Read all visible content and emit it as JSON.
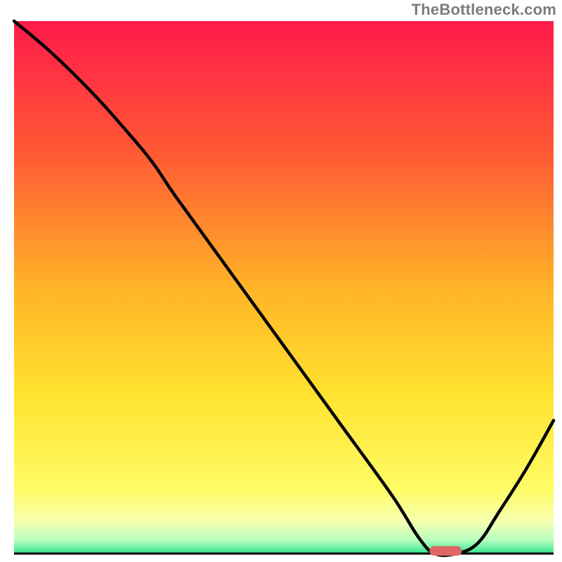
{
  "attribution": "TheBottleneck.com",
  "chart_data": {
    "type": "line",
    "title": "",
    "xlabel": "",
    "ylabel": "",
    "xlim": [
      0,
      100
    ],
    "ylim": [
      0,
      100
    ],
    "grid": false,
    "legend": false,
    "background_gradient_stops": [
      {
        "offset": 0.0,
        "color": "#ff1a4b"
      },
      {
        "offset": 0.25,
        "color": "#ff5a34"
      },
      {
        "offset": 0.5,
        "color": "#ffb327"
      },
      {
        "offset": 0.7,
        "color": "#ffe22f"
      },
      {
        "offset": 0.88,
        "color": "#fffc66"
      },
      {
        "offset": 0.94,
        "color": "#f6ffb0"
      },
      {
        "offset": 0.975,
        "color": "#b7ffc0"
      },
      {
        "offset": 1.0,
        "color": "#2fe38c"
      }
    ],
    "series": [
      {
        "name": "bottleneck-curve",
        "color": "#000000",
        "x": [
          0,
          7,
          15,
          22,
          26,
          30,
          40,
          50,
          60,
          70,
          75,
          78,
          82,
          86,
          90,
          95,
          100
        ],
        "y": [
          100,
          94,
          86,
          78,
          73,
          67,
          53,
          39,
          25,
          11,
          3,
          0,
          0,
          2,
          8,
          16,
          25
        ],
        "note": "y is percent height of plot; valley (y=0) ≈ x 78–82"
      }
    ],
    "marker": {
      "name": "optimal-range-marker",
      "color": "#e06666",
      "x_start": 77,
      "x_end": 83,
      "y": 0.5,
      "thickness_pct": 1.8
    }
  }
}
